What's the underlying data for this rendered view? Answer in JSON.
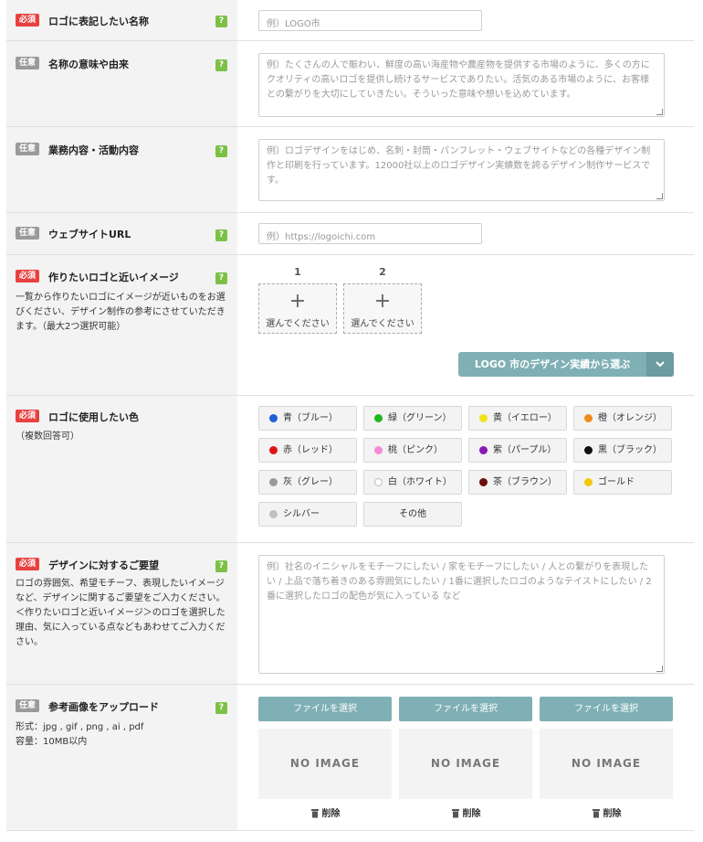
{
  "rows": {
    "logo_name": {
      "badge": "必須",
      "label": "ロゴに表記したい名称",
      "help": "?",
      "placeholder": "例）LOGO市"
    },
    "name_meaning": {
      "badge": "任意",
      "label": "名称の意味や由来",
      "help": "?",
      "placeholder": "例）たくさんの人で賑わい、鮮度の高い海産物や農産物を提供する市場のように、多くの方にクオリティの高いロゴを提供し続けるサービスでありたい。活気のある市場のように、お客様との繋がりを大切にしていきたい。そういった意味や想いを込めています。"
    },
    "business": {
      "badge": "任意",
      "label": "業務内容・活動内容",
      "help": "?",
      "placeholder": "例）ロゴデザインをはじめ、名刺・封筒・パンフレット・ウェブサイトなどの各種デザイン制作と印刷を行っています。12000社以上のロゴデザイン実績数を誇るデザイン制作サービスです。"
    },
    "website": {
      "badge": "任意",
      "label": "ウェブサイトURL",
      "help": "?",
      "placeholder": "例）https://logoichi.com"
    },
    "image": {
      "badge": "必須",
      "label": "作りたいロゴと近いイメージ",
      "help": "?",
      "description": "一覧から作りたいロゴにイメージが近いものをお選びください、デザイン制作の参考にさせていただきます。（最大2つ選択可能）",
      "slots": [
        {
          "number": "1",
          "plus": "+",
          "text": "選んでください"
        },
        {
          "number": "2",
          "plus": "+",
          "text": "選んでください"
        }
      ],
      "gallery_button": "LOGO 市のデザイン実績から選ぶ",
      "gallery_icon": "chevron-down-icon"
    },
    "colors": {
      "badge": "必須",
      "label": "ロゴに使用したい色",
      "note": "（複数回答可）",
      "options": [
        {
          "label": "青（ブルー）",
          "color": "#1f5fd6"
        },
        {
          "label": "緑（グリーン）",
          "color": "#1fb81f"
        },
        {
          "label": "黄（イエロー）",
          "color": "#f2e21a"
        },
        {
          "label": "橙（オレンジ）",
          "color": "#f08a1a"
        },
        {
          "label": "赤（レッド）",
          "color": "#e01414"
        },
        {
          "label": "桃（ピンク）",
          "color": "#f58ad6"
        },
        {
          "label": "紫（パープル）",
          "color": "#8a18b8"
        },
        {
          "label": "黒（ブラック）",
          "color": "#111111"
        },
        {
          "label": "灰（グレー）",
          "color": "#9a9a9a"
        },
        {
          "label": "白（ホワイト）",
          "color": "#ffffff"
        },
        {
          "label": "茶（ブラウン）",
          "color": "#6b1010"
        },
        {
          "label": "ゴールド",
          "color": "#f2c80f"
        },
        {
          "label": "シルバー",
          "color": "#c0c0c0"
        },
        {
          "label": "その他",
          "color": ""
        }
      ]
    },
    "request": {
      "badge": "必須",
      "label": "デザインに対するご要望",
      "help": "?",
      "description": "ロゴの雰囲気、希望モチーフ、表現したいイメージなど、デザインに関するご要望をご入力ください。＜作りたいロゴと近いイメージ＞のロゴを選択した理由、気に入っている点などもあわせてご入力ください。",
      "placeholder": "例）社名のイニシャルをモチーフにしたい / 家をモチーフにしたい / 人との繋がりを表現したい / 上品で落ち着きのある雰囲気にしたい / 1番に選択したロゴのようなテイストにしたい / 2番に選択したロゴの配色が気に入っている など"
    },
    "upload": {
      "badge": "任意",
      "label": "参考画像をアップロード",
      "help": "?",
      "format": "形式：jpg , gif , png , ai , pdf",
      "capacity": "容量：10MB以内",
      "files": [
        {
          "button": "ファイルを選択",
          "preview": "NO IMAGE",
          "delete": "削除"
        },
        {
          "button": "ファイルを選択",
          "preview": "NO IMAGE",
          "delete": "削除"
        },
        {
          "button": "ファイルを選択",
          "preview": "NO IMAGE",
          "delete": "削除"
        }
      ]
    }
  },
  "theme": {
    "required_badge": "#e8413f",
    "optional_badge": "#9a9a9a",
    "help_icon": "#7cc146",
    "accent": "#7fb0b5"
  }
}
